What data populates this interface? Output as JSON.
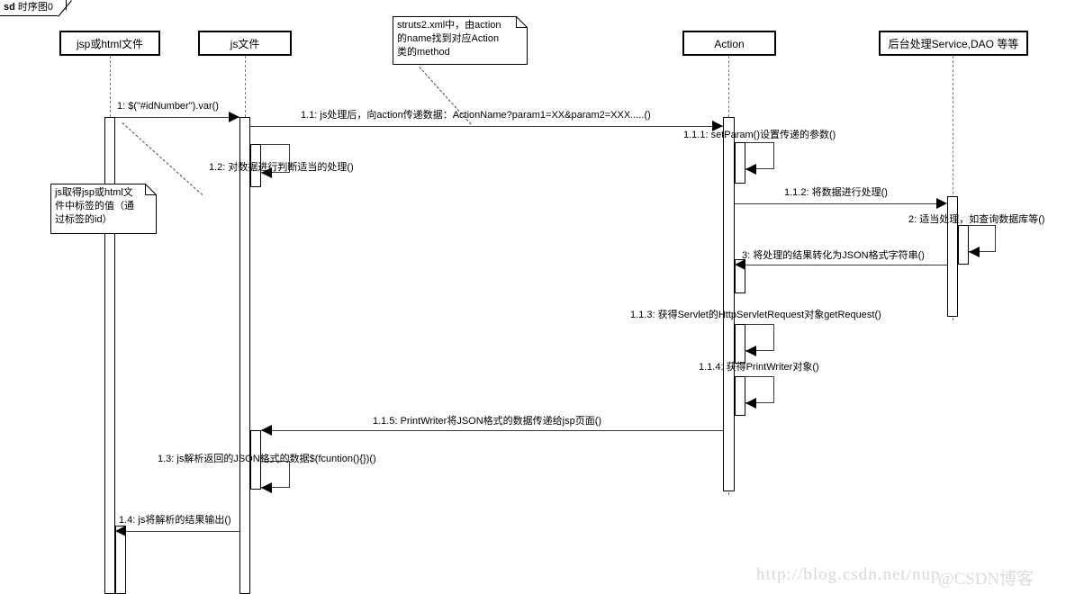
{
  "frame": {
    "keyword": "sd",
    "name": "时序图0"
  },
  "lifelines": [
    {
      "id": "jsp",
      "label": "jsp或html文件"
    },
    {
      "id": "js",
      "label": "js文件"
    },
    {
      "id": "action",
      "label": "Action"
    },
    {
      "id": "service",
      "label": "后台处理Service,DAO 等等"
    }
  ],
  "messages": [
    {
      "id": "m1",
      "label": "1: $(\"#idNumber\").var()"
    },
    {
      "id": "m1_1",
      "label": "1.1: js处理后，向action传递数据：ActionName?param1=XX&param2=XXX.....()"
    },
    {
      "id": "m1_2",
      "label": "1.2: 对数据进行判断适当的处理()"
    },
    {
      "id": "m1_1_1",
      "label": "1.1.1: setParam()设置传递的参数()"
    },
    {
      "id": "m1_1_2",
      "label": "1.1.2: 将数据进行处理()"
    },
    {
      "id": "m2",
      "label": "2: 适当处理，如查询数据库等()"
    },
    {
      "id": "m3",
      "label": "3: 将处理的结果转化为JSON格式字符串()"
    },
    {
      "id": "m1_1_3",
      "label": "1.1.3: 获得Servlet的HttpServletRequest对象getRequest()"
    },
    {
      "id": "m1_1_4",
      "label": "1.1.4: 获得PrintWriter对象()"
    },
    {
      "id": "m1_1_5",
      "label": "1.1.5: PrintWriter将JSON格式的数据传递给jsp页面()"
    },
    {
      "id": "m1_3",
      "label": "1.3: js解析返回的JSON格式的数据$(fcuntion(){})()"
    },
    {
      "id": "m1_4",
      "label": "1.4: js将解析的结果输出()"
    }
  ],
  "notes": [
    {
      "id": "note_struts",
      "text": "struts2.xml中，由action\n的name找到对应Action\n类的method"
    },
    {
      "id": "note_js",
      "text": "js取得jsp或html文\n件中标签的值（通\n过标签的id）"
    }
  ],
  "watermark": {
    "url": "http://blog.csdn.net/nup",
    "brand": "@CSDN博客"
  },
  "colors": {
    "stroke": "#000000",
    "lifeline": "#7a7a7a",
    "message": "#3a3a3a",
    "background": "#ffffff",
    "watermark": "#d8d8d8"
  }
}
